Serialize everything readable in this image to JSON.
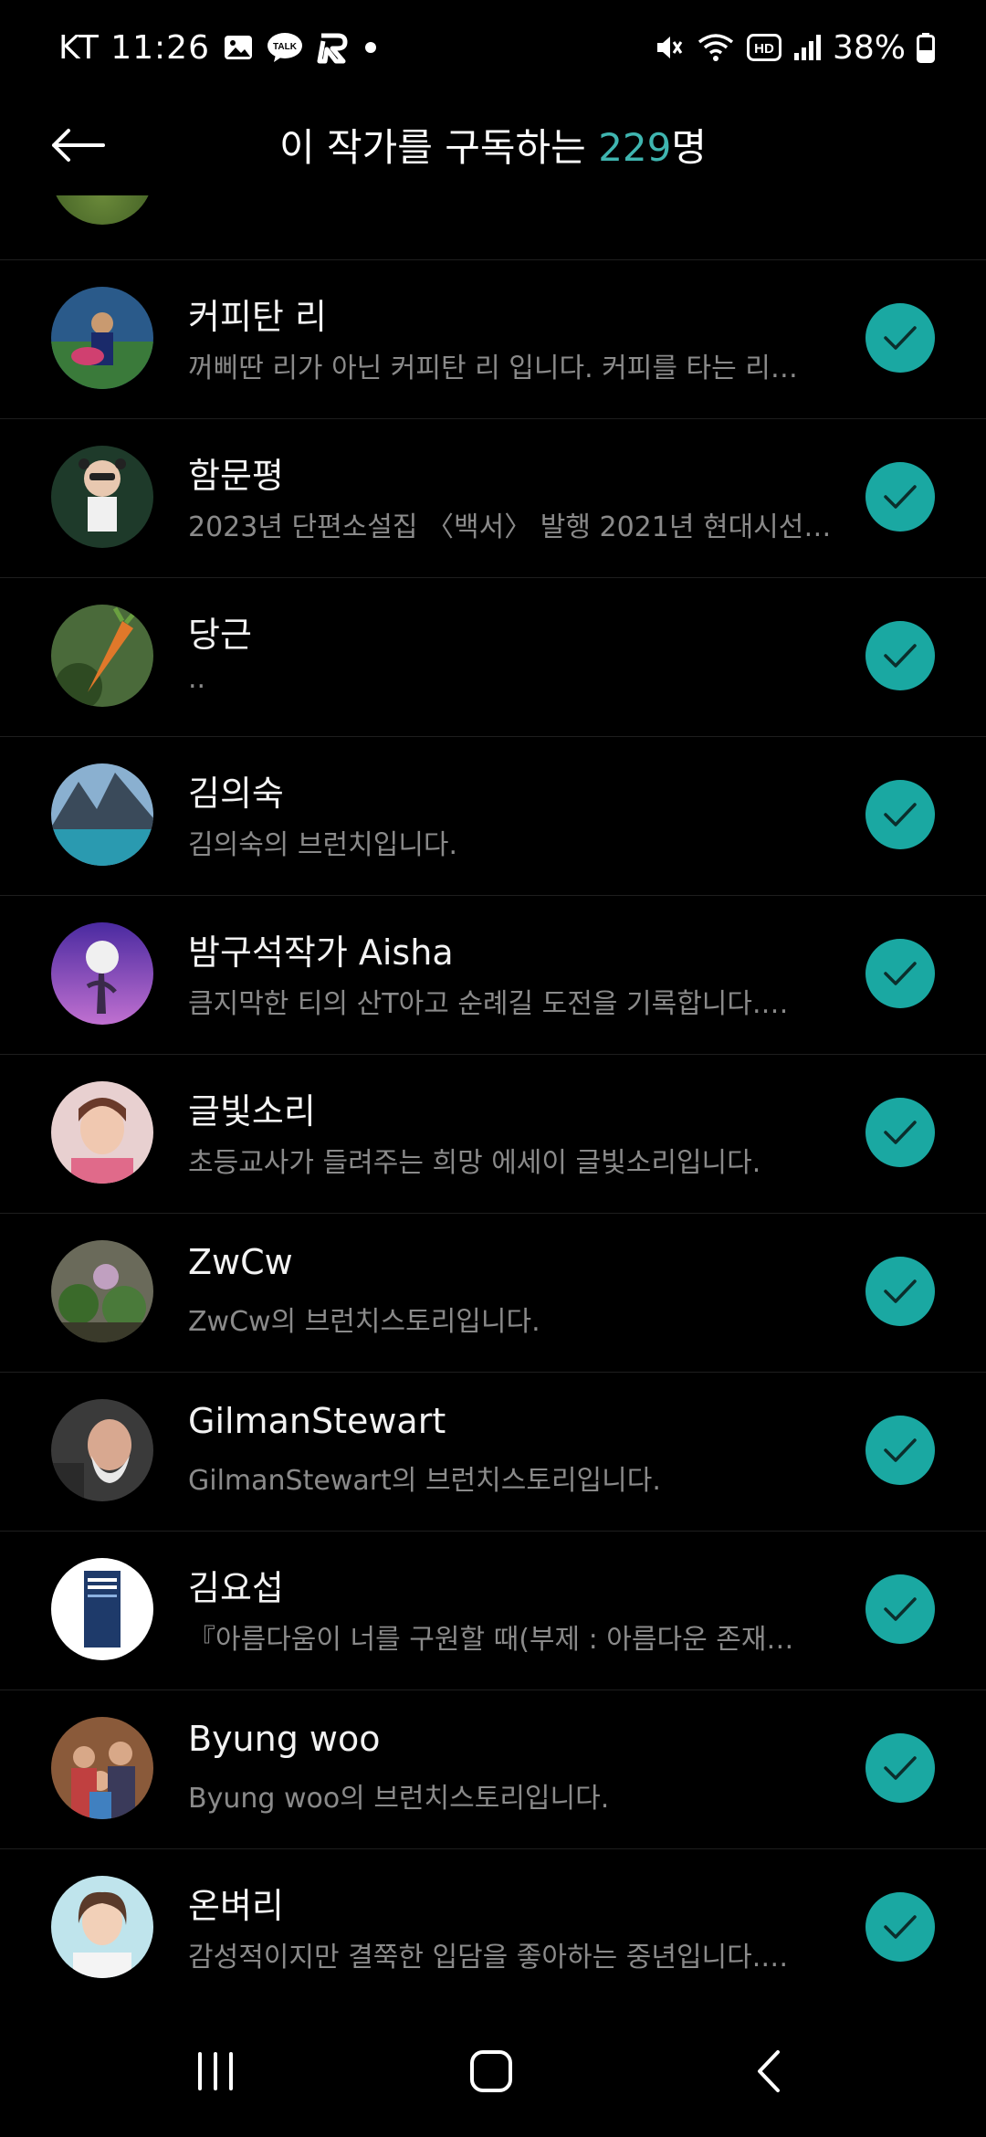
{
  "status_bar": {
    "carrier_time": "KT 11:26",
    "battery_text": "38%",
    "icons": [
      "gallery-icon",
      "talk-icon",
      "r-app-icon",
      "dot-icon",
      "mute-icon",
      "wifi-icon",
      "hd-icon",
      "signal-icon",
      "battery-icon"
    ],
    "talk_label": "TALK",
    "hd_label": "HD"
  },
  "header": {
    "title_prefix": "이 작가를 구독하는 ",
    "count": "229",
    "title_suffix": "명",
    "accent_color": "#3fb5b0"
  },
  "subscribers": [
    {
      "name": "커피탄 리",
      "desc": "꺼삐딴 리가 아닌 커피탄 리 입니다. 커피를 타는 리…"
    },
    {
      "name": "함문평",
      "desc": "2023년 단편소설집 〈백서〉 발행 2021년 현대시선…"
    },
    {
      "name": "당근",
      "desc": ".."
    },
    {
      "name": "김의숙",
      "desc": "김의숙의 브런치입니다."
    },
    {
      "name": "밤구석작가 Aisha",
      "desc": "큼지막한 티의 산T아고 순례길 도전을 기록합니다.…"
    },
    {
      "name": "글빛소리",
      "desc": "초등교사가 들려주는 희망 에세이 글빛소리입니다."
    },
    {
      "name": "ZwCw",
      "desc": "ZwCw의 브런치스토리입니다."
    },
    {
      "name": "GilmanStewart",
      "desc": "GilmanStewart의 브런치스토리입니다."
    },
    {
      "name": "김요섭",
      "desc": "『아름다움이 너를 구원할 때(부제 : 아름다운 존재…"
    },
    {
      "name": "Byung woo",
      "desc": "Byung woo의 브런치스토리입니다."
    },
    {
      "name": "온벼리",
      "desc": "감성적이지만 결쭉한 입담을 좋아하는 중년입니다.…"
    }
  ],
  "check_color": "#1aa8a2",
  "nav": {
    "icons": [
      "recent-apps-icon",
      "home-icon",
      "back-nav-icon"
    ]
  }
}
